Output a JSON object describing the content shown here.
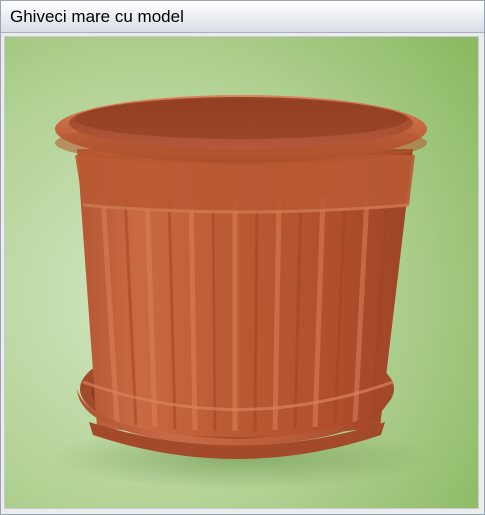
{
  "window": {
    "title": "Ghiveci mare cu model"
  },
  "image": {
    "alt": "Ghiveci mare cu model",
    "subject": "terracotta plastic flower pot with fluted sides on matching saucer",
    "colors": {
      "background_light": "#c8dfb2",
      "background_dark": "#8fbd68",
      "pot_main": "#b85a36",
      "pot_light": "#d37a52",
      "pot_dark": "#8e3f22"
    }
  }
}
